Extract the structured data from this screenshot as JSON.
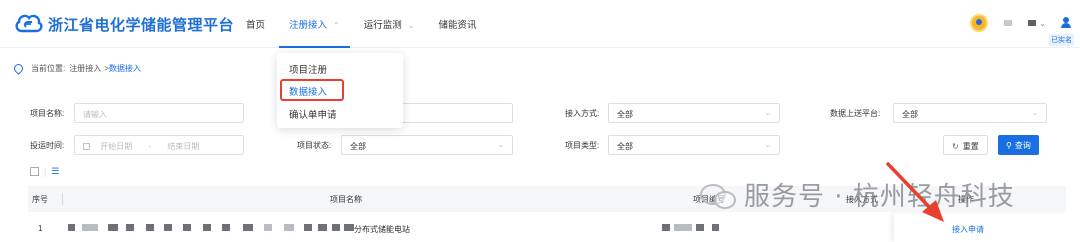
{
  "header": {
    "logo_text": "浙江省电化学储能管理平台",
    "nav": [
      {
        "label": "首页"
      },
      {
        "label": "注册接入"
      },
      {
        "label": "运行监测"
      },
      {
        "label": "储能资讯"
      }
    ],
    "verified_badge": "已实名"
  },
  "breadcrumb": {
    "prefix": "当前位置:",
    "parent": "注册接入",
    "sep": ">",
    "current": "数据接入"
  },
  "dropdown": {
    "items": [
      {
        "label": "项目注册"
      },
      {
        "label": "数据接入"
      },
      {
        "label": "确认单申请"
      }
    ]
  },
  "filters": {
    "project_name_label": "项目名称:",
    "project_name_placeholder": "请输入",
    "access_method_label": "接入方式:",
    "access_method_value": "全部",
    "upload_platform_label": "数据上送平台:",
    "upload_platform_value": "全部",
    "commission_time_label": "投运时间:",
    "start_date_placeholder": "开始日期",
    "date_sep": "-",
    "end_date_placeholder": "结束日期",
    "project_status_label": "项目状态:",
    "project_status_value": "全部",
    "project_type_label": "项目类型:",
    "project_type_value": "全部",
    "reset_label": "重置",
    "query_label": "查询"
  },
  "table": {
    "columns": [
      "序号",
      "项目名称",
      "项目编号",
      "接入方式",
      "操作"
    ],
    "rows": [
      {
        "index": "1",
        "name_suffix": "分布式储能电站",
        "action": "接入申请"
      }
    ]
  },
  "watermark": "服务号 · 杭州轻舟科技",
  "colors": {
    "accent": "#1a6fe0",
    "highlight": "#e8412e"
  }
}
